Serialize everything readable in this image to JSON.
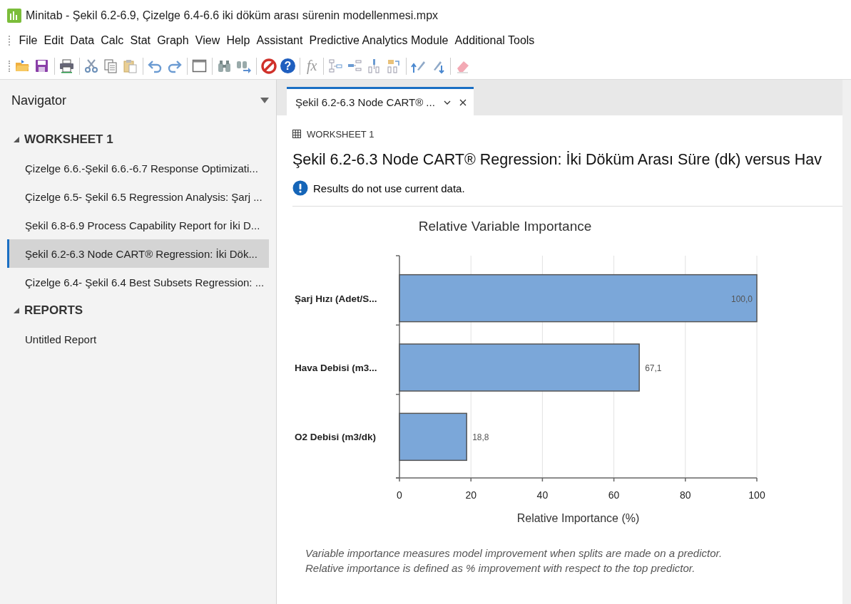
{
  "window": {
    "title": "Minitab - Şekil 6.2-6.9, Çizelge 6.4-6.6 iki döküm arası sürenin modellenmesi.mpx"
  },
  "menu": [
    "File",
    "Edit",
    "Data",
    "Calc",
    "Stat",
    "Graph",
    "View",
    "Help",
    "Assistant",
    "Predictive Analytics Module",
    "Additional Tools"
  ],
  "toolbar": {
    "help_label": "?",
    "formula_label": "fx"
  },
  "navigator": {
    "title": "Navigator",
    "sections": [
      {
        "label": "WORKSHEET 1",
        "expanded": true,
        "items": [
          {
            "label": "Çizelge 6.6.-Şekil 6.6.-6.7 Response Optimizati...",
            "selected": false
          },
          {
            "label": "Çizelge 6.5- Şekil 6.5 Regression Analysis: Şarj ...",
            "selected": false
          },
          {
            "label": "Şekil 6.8-6.9 Process Capability Report for İki D...",
            "selected": false
          },
          {
            "label": "Şekil 6.2-6.3 Node CART® Regression: İki Dök...",
            "selected": true
          },
          {
            "label": "Çizelge 6.4- Şekil 6.4 Best Subsets Regression: ...",
            "selected": false
          }
        ]
      },
      {
        "label": "REPORTS",
        "expanded": true,
        "items": [
          {
            "label": "Untitled Report",
            "selected": false
          }
        ]
      }
    ]
  },
  "tabs": [
    {
      "label": "Şekil 6.2-6.3 Node CART® ...",
      "selected": true
    }
  ],
  "output": {
    "worksheet": "WORKSHEET 1",
    "heading": "Şekil 6.2-6.3 Node CART® Regression: İki Döküm Arası Süre (dk) versus Hav",
    "notice": "Results do not use current data.",
    "chart_data": {
      "type": "bar",
      "orientation": "horizontal",
      "title": "Relative Variable Importance",
      "xlabel": "Relative Importance (%)",
      "categories": [
        "Şarj Hızı (Adet/S...",
        "Hava Debisi (m3...",
        "O2 Debisi (m3/dk)"
      ],
      "values": [
        100,
        67.1,
        18.8
      ],
      "value_labels": [
        "100,0",
        "67,1",
        "18,8"
      ],
      "xlim": [
        0,
        100
      ],
      "xticks": [
        0,
        20,
        40,
        60,
        80,
        100
      ],
      "grid": true
    },
    "footnotes": [
      "Variable importance measures model improvement when splits are made on a predictor.",
      "Relative importance is defined as % improvement with respect to the top predictor."
    ]
  }
}
